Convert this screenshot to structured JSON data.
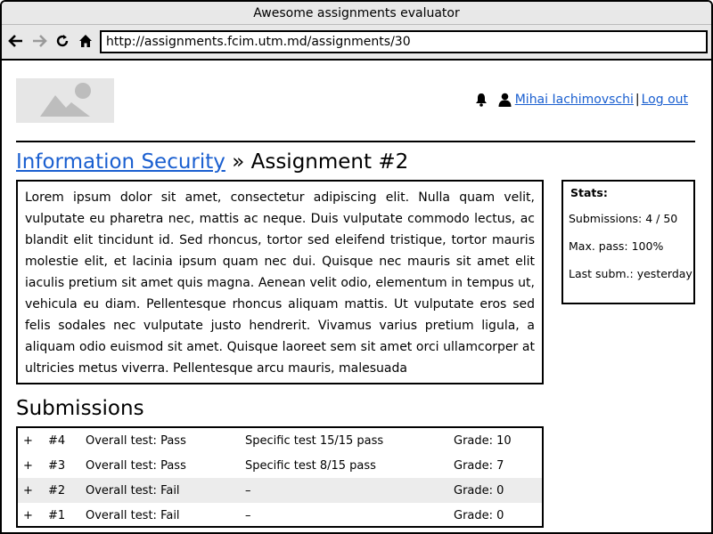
{
  "window": {
    "title": "Awesome assignments evaluator"
  },
  "browser": {
    "url": "http://assignments.fcim.utm.md/assignments/30"
  },
  "header": {
    "user_name": "Mihai Iachimovschi",
    "separator": "|",
    "logout_label": "Log out"
  },
  "breadcrumb": {
    "course": "Information Security",
    "separator": "»",
    "assignment": "Assignment #2"
  },
  "description": "Lorem ipsum dolor sit amet, consectetur adipiscing elit. Nulla quam velit, vulputate eu pharetra nec, mattis ac neque. Duis vulputate commodo lectus, ac blandit elit tincidunt id. Sed rhoncus, tortor sed eleifend tristique, tortor mauris molestie elit, et lacinia ipsum quam nec dui. Quisque nec mauris sit amet elit iaculis pretium sit amet quis magna. Aenean velit odio, elementum in tempus ut, vehicula eu diam. Pellentesque rhoncus aliquam mattis. Ut vulputate eros sed felis sodales nec vulputate justo hendrerit. Vivamus varius pretium ligula, a aliquam odio euismod sit amet. Quisque laoreet sem sit amet orci ullamcorper at ultricies metus viverra. Pellentesque arcu mauris, malesuada",
  "stats": {
    "title": "Stats:",
    "submissions": "Submissions: 4 / 50",
    "max_pass": "Max. pass: 100%",
    "last_submission": "Last subm.: yesterday"
  },
  "submissions": {
    "title": "Submissions",
    "rows": [
      {
        "expand": "+",
        "number": "#4",
        "overall": "Overall test: Pass",
        "specific": "Specific test 15/15 pass",
        "grade": "Grade: 10"
      },
      {
        "expand": "+",
        "number": "#3",
        "overall": "Overall test: Pass",
        "specific": "Specific test 8/15 pass",
        "grade": "Grade: 7"
      },
      {
        "expand": "+",
        "number": "#2",
        "overall": "Overall test: Fail",
        "specific": "–",
        "grade": "Grade: 0"
      },
      {
        "expand": "+",
        "number": "#1",
        "overall": "Overall test: Fail",
        "specific": "–",
        "grade": "Grade: 0"
      }
    ]
  },
  "icons": {
    "back": "back-arrow-icon",
    "forward": "forward-arrow-icon",
    "reload": "reload-icon",
    "home": "home-icon",
    "notifications": "bell-icon",
    "user": "user-icon",
    "logo": "image-placeholder-icon"
  }
}
